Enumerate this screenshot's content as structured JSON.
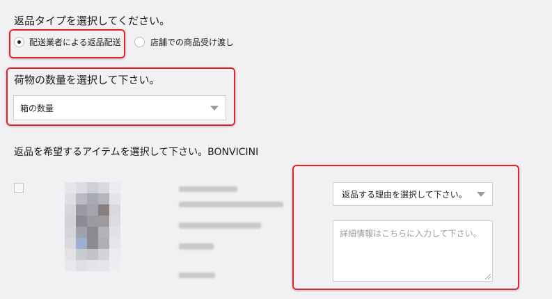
{
  "return_type": {
    "heading": "返品タイプを選択してください。",
    "options": [
      {
        "label": "配送業者による返品配送",
        "selected": true
      },
      {
        "label": "店舗での商品受け渡し",
        "selected": false
      }
    ]
  },
  "quantity": {
    "heading": "荷物の数量を選択して下さい。",
    "select_value": "箱の数量"
  },
  "items": {
    "heading": "返品を希望するアイテムを選択して下さい。BONVICINI",
    "reason_select_value": "返品する理由を選択して下さい。",
    "details_placeholder": "詳細情報はこちらに入力して下さい。"
  },
  "colors": {
    "highlight": "#e0242e",
    "background": "#f1f1f3"
  }
}
